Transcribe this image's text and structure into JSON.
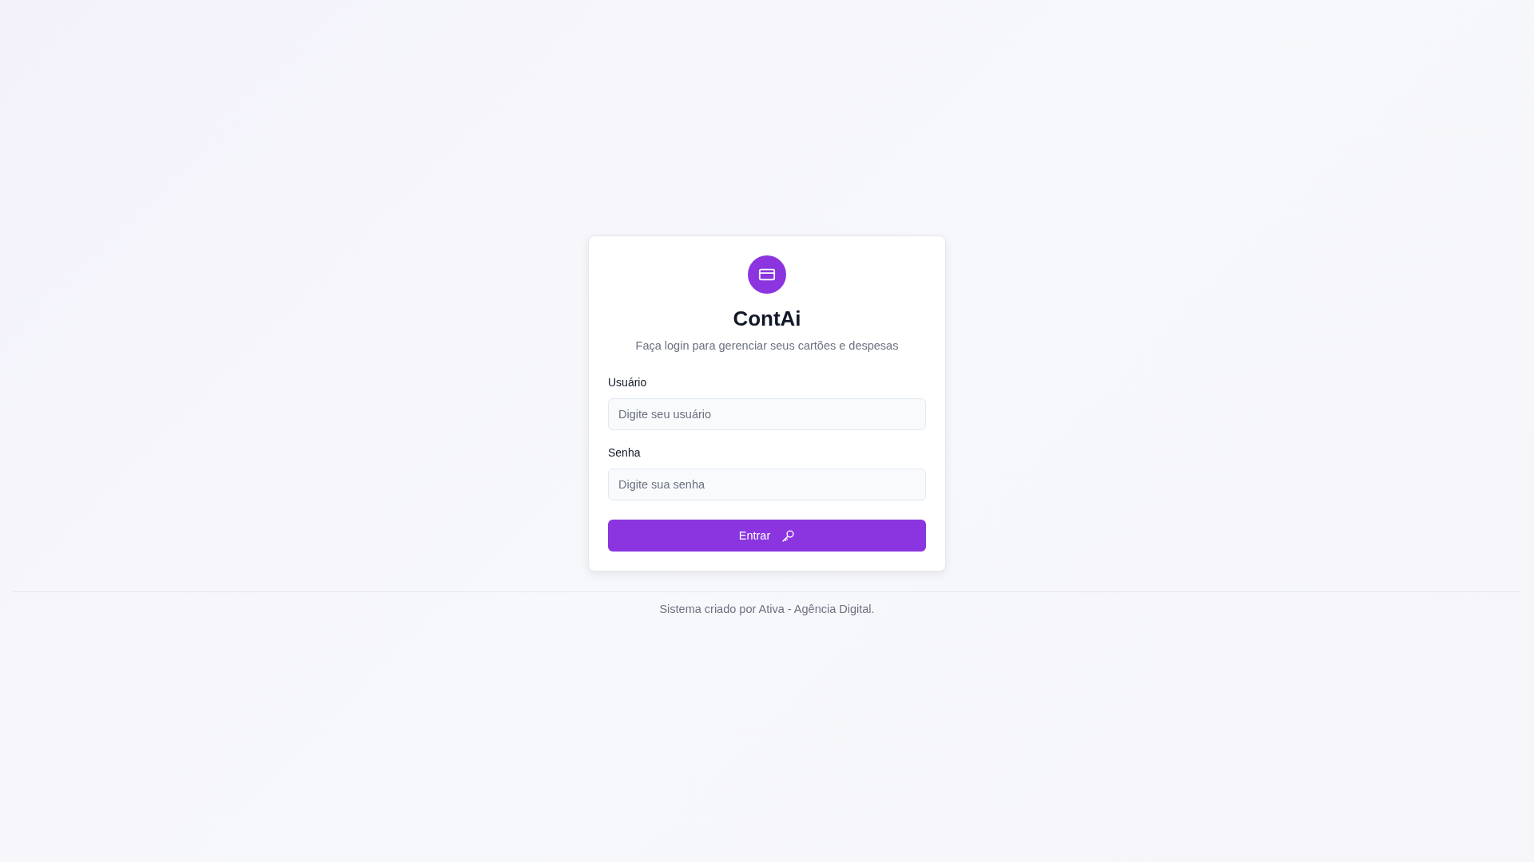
{
  "brand": {
    "title": "ContAi",
    "subtitle": "Faça login para gerenciar seus cartões e despesas"
  },
  "fields": [
    {
      "label": "Usuário",
      "placeholder": "Digite seu usuário"
    },
    {
      "label": "Senha",
      "placeholder": "Digite sua senha"
    }
  ],
  "submit": {
    "label": "Entrar"
  },
  "footer": {
    "text": "Sistema criado por Ativa - Agência Digital."
  }
}
